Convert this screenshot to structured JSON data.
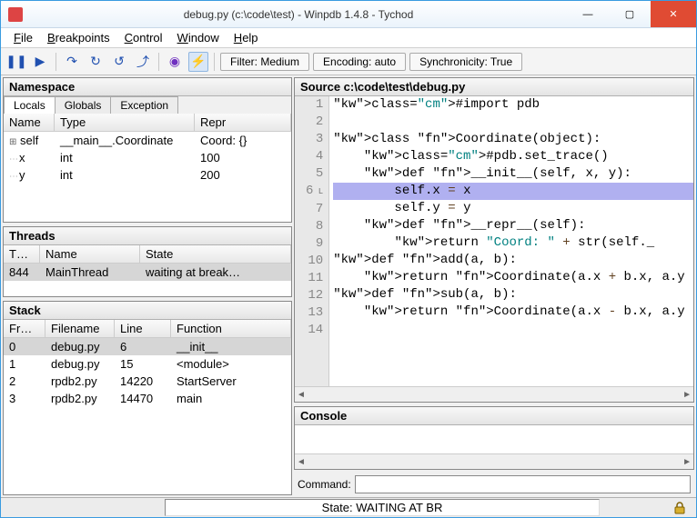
{
  "window": {
    "title": "debug.py (c:\\code\\test) - Winpdb 1.4.8 - Tychod",
    "min": "—",
    "max": "▢",
    "close": "✕"
  },
  "menu": {
    "file": "File",
    "breakpoints": "Breakpoints",
    "control": "Control",
    "window": "Window",
    "help": "Help"
  },
  "toolbar": {
    "filter": "Filter: Medium",
    "encoding": "Encoding: auto",
    "sync": "Synchronicity: True"
  },
  "namespace": {
    "title": "Namespace",
    "tabs": {
      "locals": "Locals",
      "globals": "Globals",
      "exception": "Exception"
    },
    "headers": {
      "name": "Name",
      "type": "Type",
      "repr": "Repr"
    },
    "rows": [
      {
        "name": "self",
        "type": "__main__.Coordinate",
        "repr": "Coord: {}"
      },
      {
        "name": "x",
        "type": "int",
        "repr": "100"
      },
      {
        "name": "y",
        "type": "int",
        "repr": "200"
      }
    ]
  },
  "threads": {
    "title": "Threads",
    "headers": {
      "tid": "T…",
      "name": "Name",
      "state": "State"
    },
    "rows": [
      {
        "tid": "844",
        "name": "MainThread",
        "state": "waiting at break…"
      }
    ]
  },
  "stack": {
    "title": "Stack",
    "headers": {
      "frame": "Fr…",
      "filename": "Filename",
      "line": "Line",
      "function": "Function"
    },
    "rows": [
      {
        "frame": "0",
        "filename": "debug.py",
        "line": "6",
        "function": "__init__"
      },
      {
        "frame": "1",
        "filename": "debug.py",
        "line": "15",
        "function": "<module>"
      },
      {
        "frame": "2",
        "filename": "rpdb2.py",
        "line": "14220",
        "function": "StartServer"
      },
      {
        "frame": "3",
        "filename": "rpdb2.py",
        "line": "14470",
        "function": "main"
      }
    ]
  },
  "source": {
    "title": "Source c:\\code\\test\\debug.py",
    "current_line": 6,
    "lines": [
      "#import pdb",
      "",
      "class Coordinate(object):",
      "    #pdb.set_trace()",
      "    def __init__(self, x, y):",
      "        self.x = x",
      "        self.y = y",
      "    def __repr__(self):",
      "        return \"Coord: \" + str(self._",
      "def add(a, b):",
      "    return Coordinate(a.x + b.x, a.y",
      "def sub(a, b):",
      "    return Coordinate(a.x - b.x, a.y",
      ""
    ]
  },
  "console": {
    "title": "Console",
    "command_label": "Command:"
  },
  "status": {
    "state": "State: WAITING AT BR"
  }
}
